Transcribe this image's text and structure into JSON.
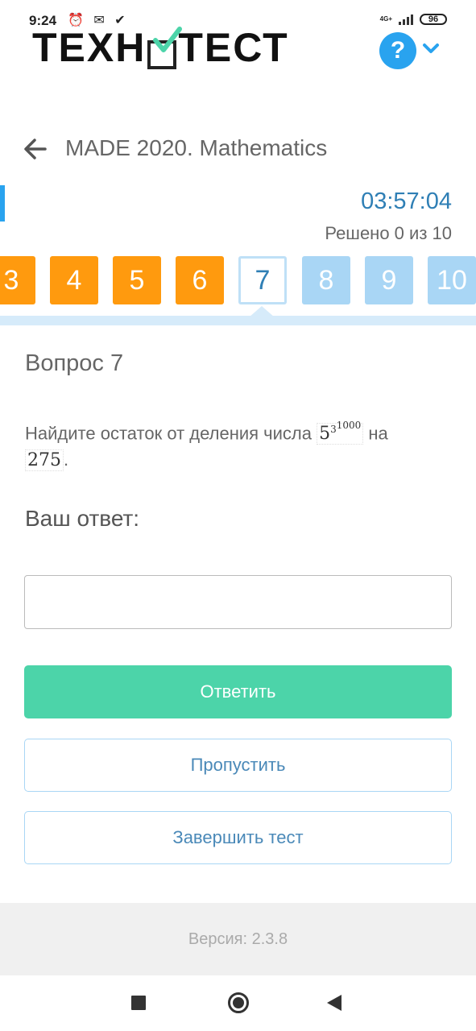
{
  "status_bar": {
    "time": "9:24",
    "left_icons": "⏰ ✉ ✔",
    "network": "4G+",
    "battery": "96"
  },
  "header": {
    "logo_left": "ТЕХН",
    "logo_right": "ТЕСТ",
    "help_label": "?"
  },
  "page": {
    "title": "MADE 2020. Mathematics"
  },
  "timer": {
    "time": "03:57:04",
    "solved": "Решено 0 из 10"
  },
  "question_nav": {
    "items": [
      {
        "label": "3",
        "state": "answered"
      },
      {
        "label": "4",
        "state": "answered"
      },
      {
        "label": "5",
        "state": "answered"
      },
      {
        "label": "6",
        "state": "answered"
      },
      {
        "label": "7",
        "state": "current"
      },
      {
        "label": "8",
        "state": "pending"
      },
      {
        "label": "9",
        "state": "pending"
      },
      {
        "label": "10",
        "state": "pending"
      }
    ]
  },
  "question": {
    "heading": "Вопрос 7",
    "text_before": "Найдите остаток от деления числа ",
    "math_base": "5",
    "math_exp_base": "3",
    "math_exp_power": "1000",
    "text_middle": " на",
    "math_divisor": "275",
    "text_end": "."
  },
  "answer": {
    "label": "Ваш ответ:",
    "value": "",
    "placeholder": ""
  },
  "buttons": {
    "submit": "Ответить",
    "skip": "Пропустить",
    "finish": "Завершить тест"
  },
  "footer": {
    "version": "Версия: 2.3.8"
  },
  "colors": {
    "accent_blue": "#29a3ef",
    "orange": "#ff9a0e",
    "green": "#4cd4a9",
    "light_blue": "#a9d6f5"
  }
}
